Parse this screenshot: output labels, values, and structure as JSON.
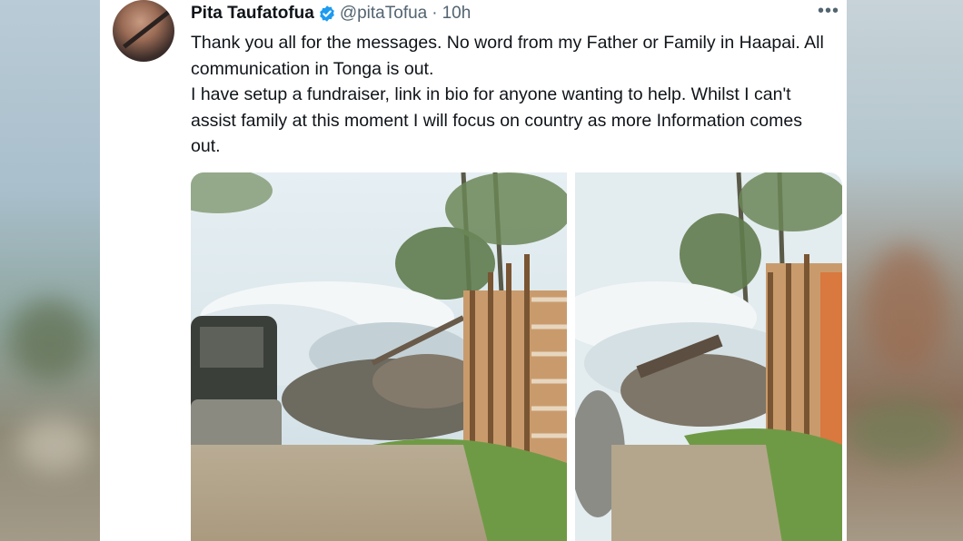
{
  "tweet": {
    "author_name": "Pita Taufatofua",
    "handle": "@pitaTofua",
    "separator": "·",
    "time": "10h",
    "more_label": "•••",
    "paragraphs": [
      "Thank you all for the messages. No word from my Father or Family in Haapai. All communication in Tonga is out.",
      "I have setup a fundraiser, link in bio for anyone wanting to help. Whilst I can't assist family at this moment I will focus on country as more Information comes out."
    ]
  },
  "colors": {
    "verified_badge": "#1d9bf0",
    "text_primary": "#0f1419",
    "text_secondary": "#536471"
  },
  "icons": {
    "verified": "verified-badge-icon",
    "more": "more-options-icon"
  }
}
